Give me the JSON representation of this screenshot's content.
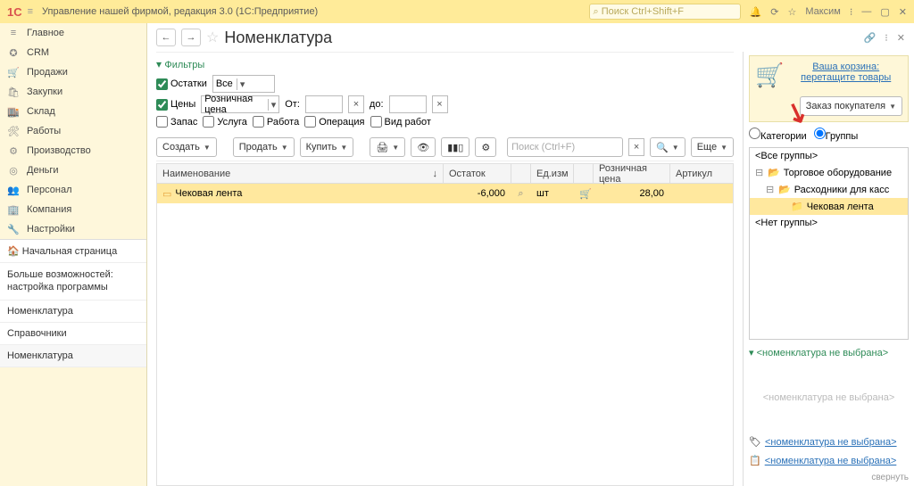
{
  "titlebar": {
    "logo": "1C",
    "title": "Управление нашей фирмой, редакция 3.0  (1С:Предприятие)",
    "search_placeholder": "Поиск Ctrl+Shift+F",
    "user": "Максим"
  },
  "sidebar": {
    "items": [
      {
        "icon": "≡",
        "label": "Главное"
      },
      {
        "icon": "✪",
        "label": "CRM"
      },
      {
        "icon": "🛒",
        "label": "Продажи"
      },
      {
        "icon": "🛍",
        "label": "Закупки"
      },
      {
        "icon": "🏬",
        "label": "Склад"
      },
      {
        "icon": "🛠",
        "label": "Работы"
      },
      {
        "icon": "⚙",
        "label": "Производство"
      },
      {
        "icon": "◎",
        "label": "Деньги"
      },
      {
        "icon": "👥",
        "label": "Персонал"
      },
      {
        "icon": "🏢",
        "label": "Компания"
      },
      {
        "icon": "🔧",
        "label": "Настройки"
      }
    ],
    "home": "Начальная страница",
    "more": "Больше возможностей: настройка программы",
    "sec1": "Номенклатура",
    "sec2": "Справочники",
    "sec3": "Номенклатура"
  },
  "page": {
    "title": "Номенклатура",
    "filters_label": "Фильтры",
    "filter_ostatki": "Остатки",
    "filter_ostatki_val": "Все",
    "filter_ceny": "Цены",
    "filter_ceny_val": "Розничная цена",
    "filter_ot": "От:",
    "filter_do": "до:",
    "chk_zapas": "Запас",
    "chk_usluga": "Услуга",
    "chk_rabota": "Работа",
    "chk_oper": "Операция",
    "chk_vidrabot": "Вид работ"
  },
  "toolbar": {
    "create": "Создать",
    "sell": "Продать",
    "buy": "Купить",
    "more": "Еще",
    "search_placeholder": "Поиск (Ctrl+F)"
  },
  "table": {
    "h_name": "Наименование",
    "h_ost": "Остаток",
    "h_ed": "Ед.изм",
    "h_price": "Розничная цена",
    "h_art": "Артикул",
    "rows": [
      {
        "name": "Чековая лента",
        "ost": "-6,000",
        "ed": "шт",
        "price": "28,00",
        "art": ""
      }
    ]
  },
  "right": {
    "cart_line1": "Ваша корзина:",
    "cart_line2": "перетащите товары",
    "order_btn": "Заказ покупателя",
    "radio_cat": "Категории",
    "radio_grp": "Группы",
    "tree": {
      "all": "<Все группы>",
      "n1": "Торговое оборудование",
      "n2": "Расходники для касс",
      "n3": "Чековая лента",
      "none": "<Нет группы>"
    },
    "panel_title": "<номенклатура не выбрана>",
    "panel_placeholder": "<номенклатура не выбрана>",
    "foot1": "<номенклатура не выбрана>",
    "foot2": "<номенклатура не выбрана>",
    "collapse": "свернуть"
  }
}
